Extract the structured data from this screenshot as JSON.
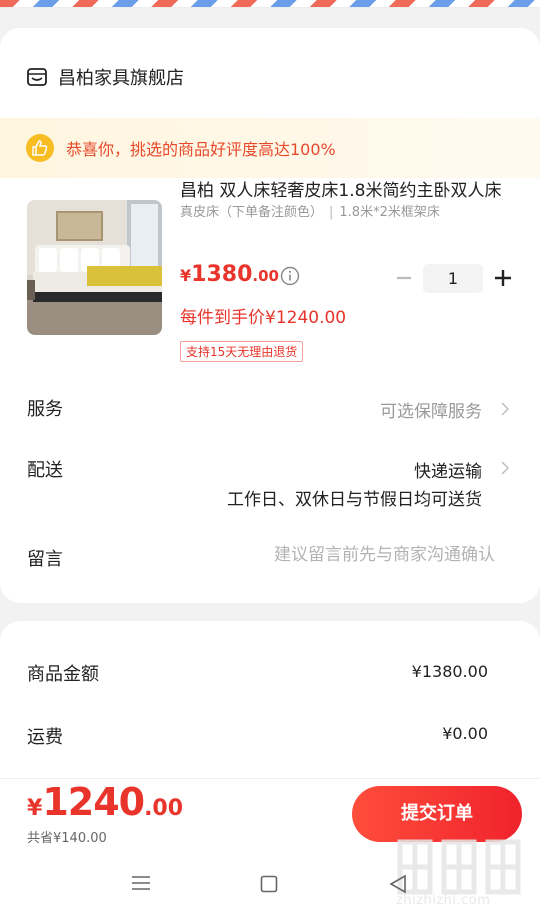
{
  "shop": {
    "name": "昌柏家具旗舰店",
    "icon": "shop-icon"
  },
  "banner": {
    "text": "恭喜你，挑选的商品好评度高达100%",
    "icon": "thumbs-up-icon",
    "icon_color": "#f8bd23"
  },
  "product": {
    "title": "昌柏 双人床轻奢皮床1.8米简约主卧双人床",
    "spec_color": "真皮床（下单备注颜色）",
    "spec_size": "1.8米*2米框架床",
    "price_currency": "¥",
    "price_int": "1380",
    "price_dec": ".00",
    "deal_price": "每件到手价¥1240.00",
    "return_tag": "支持15天无理由退货",
    "quantity": "1",
    "image_icon": "bed-product-image"
  },
  "rows": {
    "service": {
      "label": "服务",
      "value": "可选保障服务"
    },
    "delivery": {
      "label": "配送",
      "value": "快递运输",
      "sub": "工作日、双休日与节假日均可送货"
    },
    "message": {
      "label": "留言",
      "placeholder": "建议留言前先与商家沟通确认"
    }
  },
  "summary": {
    "goods": {
      "label": "商品金额",
      "value": "¥1380.00"
    },
    "shipping": {
      "label": "运费",
      "value": "¥0.00"
    }
  },
  "footer": {
    "total_currency": "¥",
    "total_int": "1240",
    "total_dec": ".00",
    "saving": "共省¥140.00",
    "submit_label": "提交订单"
  },
  "watermark": {
    "text": "zhizhizhi.com"
  },
  "colors": {
    "accent": "#e8342b",
    "banner_text": "#e8492b",
    "muted": "#999999"
  }
}
